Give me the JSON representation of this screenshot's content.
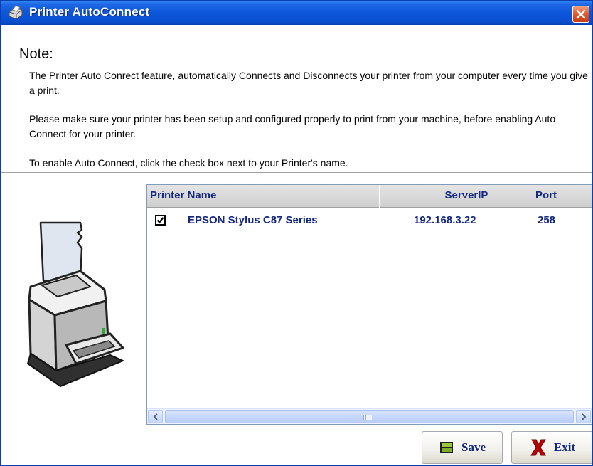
{
  "window": {
    "title": "Printer AutoConnect",
    "close_icon": "close-icon"
  },
  "note": {
    "heading": "Note:",
    "paragraph1": "The Printer Auto Conrect feature, automatically Connects and Disconnects your printer from your computer every time you give a print.",
    "paragraph2": "Please make sure your printer has been setup and configured properly to print from your machine, before enabling Auto Connect for your printer.",
    "paragraph3": "To enable Auto Connect, click the check box next to your Printer's name."
  },
  "printer_list": {
    "columns": {
      "name": "Printer Name",
      "ip": "ServerIP",
      "port": "Port"
    },
    "rows": [
      {
        "checked": true,
        "name": "EPSON Stylus C87 Series",
        "ip": "192.168.3.22",
        "port": "258"
      }
    ]
  },
  "buttons": {
    "save": "Save",
    "exit": "Exit"
  },
  "colors": {
    "title_bar": "#0d55d9",
    "list_text": "#14287e",
    "close_button": "#e55a2a"
  }
}
